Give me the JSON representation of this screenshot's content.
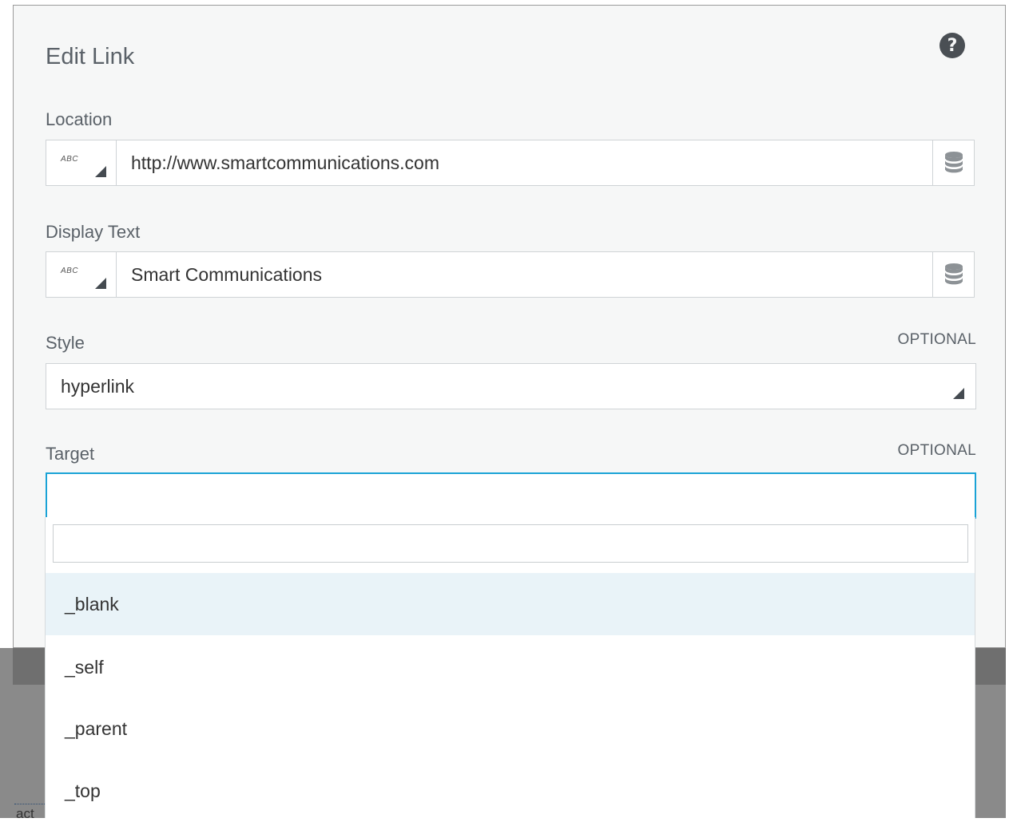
{
  "dialog": {
    "title": "Edit Link",
    "help_icon": "question-circle-icon"
  },
  "location": {
    "label": "Location",
    "type_badge": "ABC",
    "value": "http://www.smartcommunications.com",
    "db_icon": "database-icon"
  },
  "display_text": {
    "label": "Display Text",
    "type_badge": "ABC",
    "value": "Smart Communications",
    "db_icon": "database-icon"
  },
  "style": {
    "label": "Style",
    "optional_label": "OPTIONAL",
    "value": "hyperlink"
  },
  "target": {
    "label": "Target",
    "optional_label": "OPTIONAL",
    "value": "",
    "search_value": "",
    "options": [
      {
        "label": "_blank",
        "highlighted": true
      },
      {
        "label": "_self",
        "highlighted": false
      },
      {
        "label": "_parent",
        "highlighted": false
      },
      {
        "label": "_top",
        "highlighted": false
      }
    ]
  },
  "background_fragment": "act",
  "colors": {
    "focus_border": "#1aa3d6",
    "highlight_bg": "#e9f3f8",
    "dialog_bg": "#f6f7f7"
  }
}
